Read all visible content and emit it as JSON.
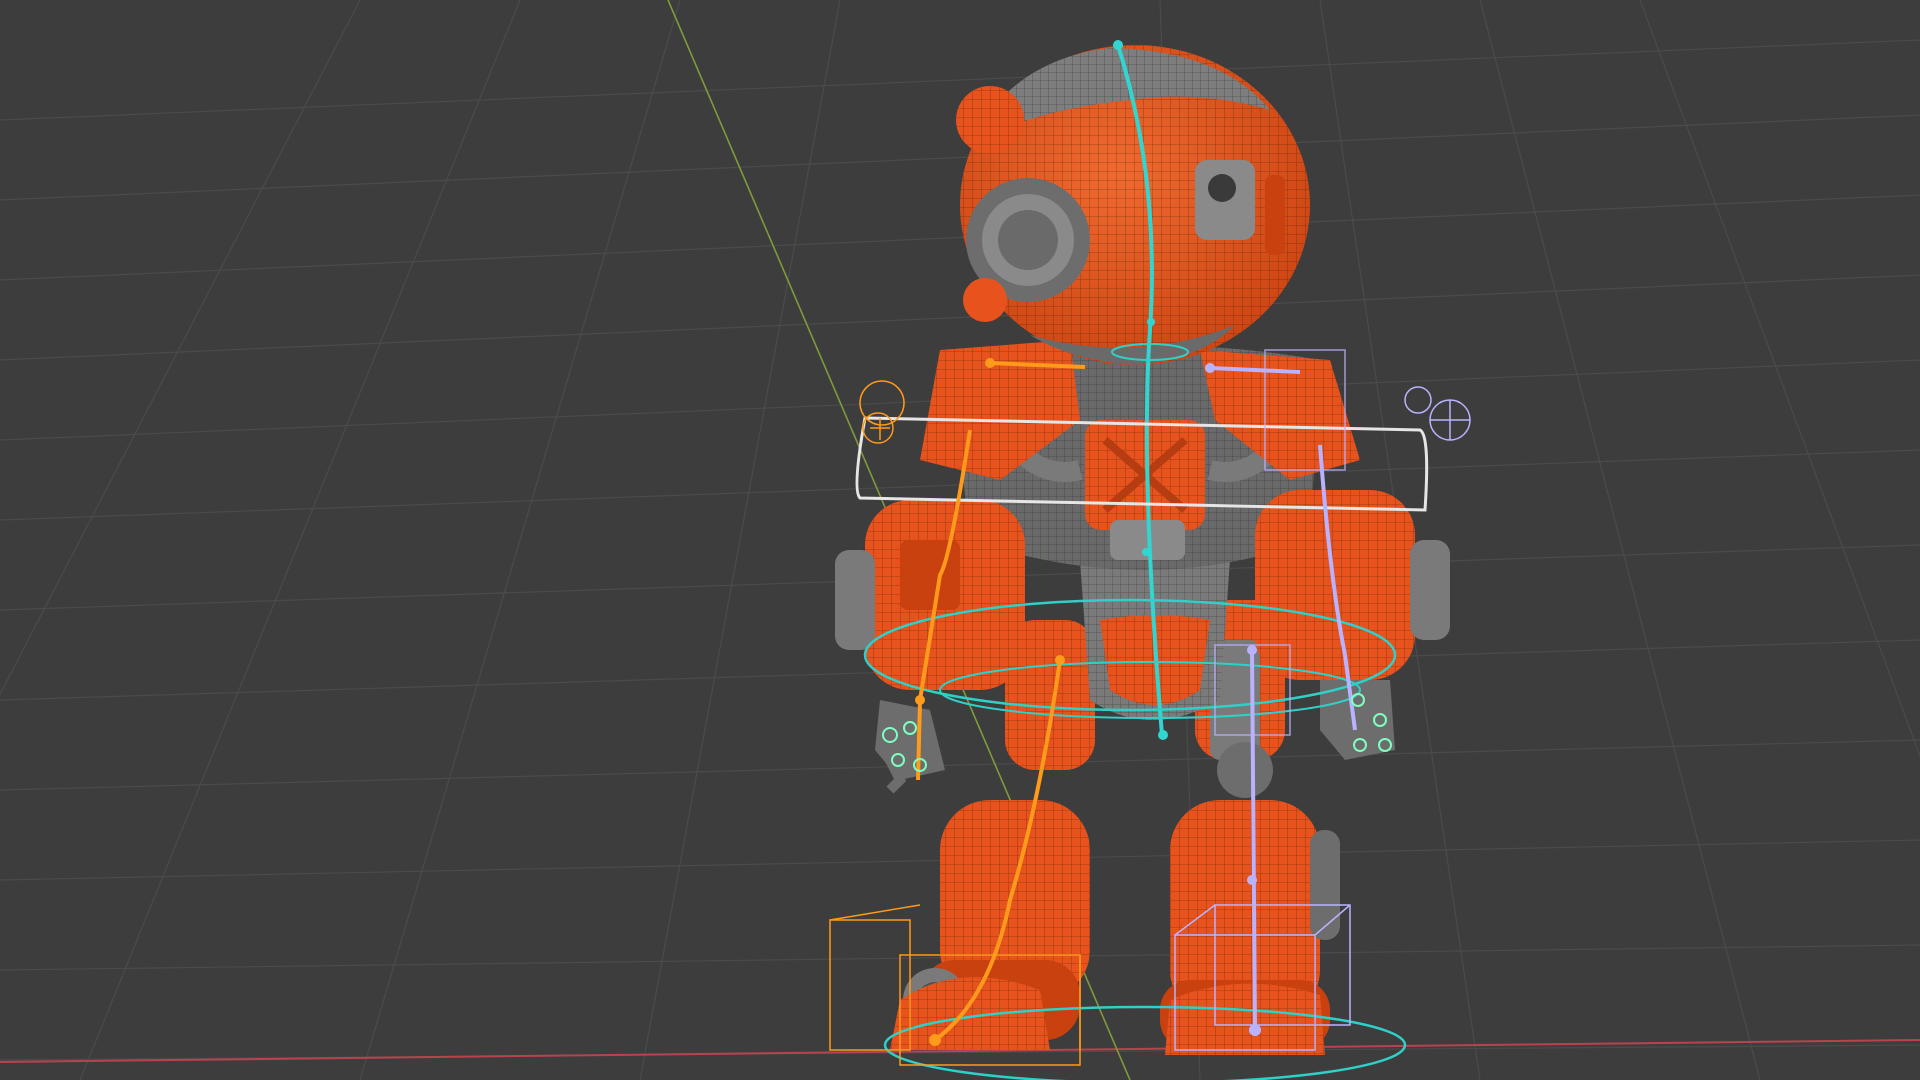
{
  "viewport": {
    "background": "#3d3d3d",
    "grid_color": "#4a4a4a",
    "axis_x_color": "#b8434e",
    "axis_y_color": "#7e9a3c"
  },
  "robot": {
    "armor_color": "#e8531d",
    "armor_shadow": "#b63d12",
    "metal_color": "#7a7a7a",
    "metal_dark": "#4c4c4c",
    "wire_color": "#2a1a10"
  },
  "rig": {
    "spine_color": "#31d6d0",
    "left_side_color": "#ff9a1a",
    "right_side_color": "#b9b3ff",
    "ring_color": "#2fd0c8",
    "torso_control_color": "#e6e6e6"
  }
}
